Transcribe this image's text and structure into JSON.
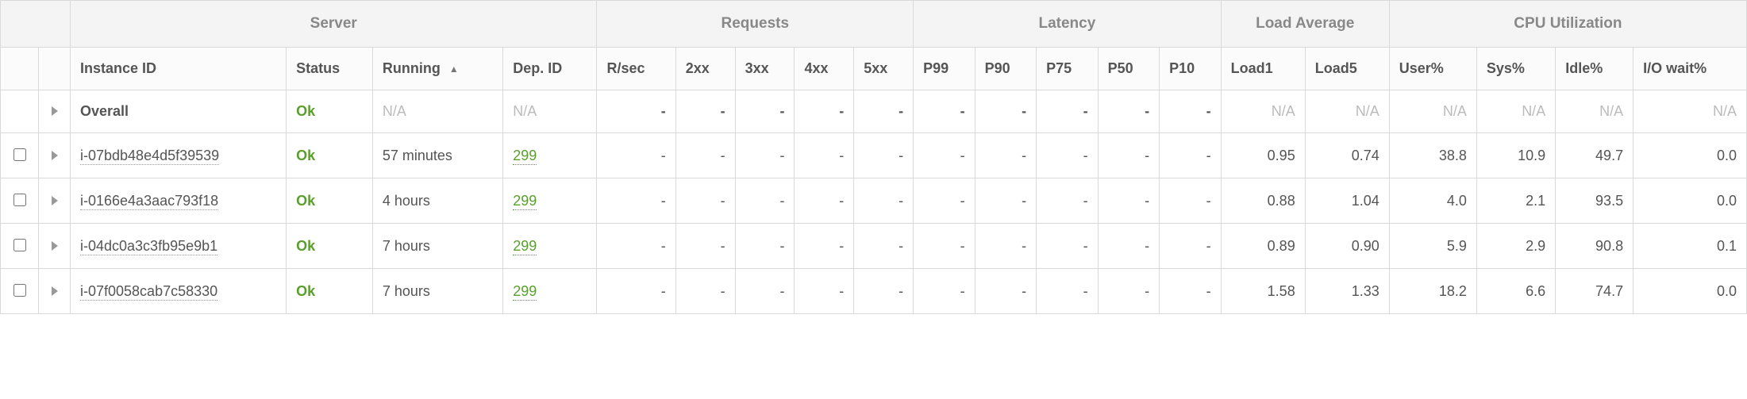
{
  "groups": {
    "server": "Server",
    "requests": "Requests",
    "latency": "Latency",
    "load": "Load Average",
    "cpu": "CPU Utilization"
  },
  "columns": {
    "instance_id": "Instance ID",
    "status": "Status",
    "running": "Running",
    "dep_id": "Dep. ID",
    "rsec": "R/sec",
    "c2xx": "2xx",
    "c3xx": "3xx",
    "c4xx": "4xx",
    "c5xx": "5xx",
    "p99": "P99",
    "p90": "P90",
    "p75": "P75",
    "p50": "P50",
    "p10": "P10",
    "load1": "Load1",
    "load5": "Load5",
    "user": "User%",
    "sys": "Sys%",
    "idle": "Idle%",
    "iowait": "I/O wait%"
  },
  "sort": {
    "column": "running",
    "indicator": "▲"
  },
  "na_label": "N/A",
  "dash": "-",
  "overall": {
    "label": "Overall",
    "status": "Ok",
    "running": "N/A",
    "dep_id": "N/A",
    "rsec": "-",
    "c2xx": "-",
    "c3xx": "-",
    "c4xx": "-",
    "c5xx": "-",
    "p99": "-",
    "p90": "-",
    "p75": "-",
    "p50": "-",
    "p10": "-",
    "load1": "N/A",
    "load5": "N/A",
    "user": "N/A",
    "sys": "N/A",
    "idle": "N/A",
    "iowait": "N/A"
  },
  "rows": [
    {
      "instance_id": "i-07bdb48e4d5f39539",
      "status": "Ok",
      "running": "57 minutes",
      "dep_id": "299",
      "rsec": "-",
      "c2xx": "-",
      "c3xx": "-",
      "c4xx": "-",
      "c5xx": "-",
      "p99": "-",
      "p90": "-",
      "p75": "-",
      "p50": "-",
      "p10": "-",
      "load1": "0.95",
      "load5": "0.74",
      "user": "38.8",
      "sys": "10.9",
      "idle": "49.7",
      "iowait": "0.0"
    },
    {
      "instance_id": "i-0166e4a3aac793f18",
      "status": "Ok",
      "running": "4 hours",
      "dep_id": "299",
      "rsec": "-",
      "c2xx": "-",
      "c3xx": "-",
      "c4xx": "-",
      "c5xx": "-",
      "p99": "-",
      "p90": "-",
      "p75": "-",
      "p50": "-",
      "p10": "-",
      "load1": "0.88",
      "load5": "1.04",
      "user": "4.0",
      "sys": "2.1",
      "idle": "93.5",
      "iowait": "0.0"
    },
    {
      "instance_id": "i-04dc0a3c3fb95e9b1",
      "status": "Ok",
      "running": "7 hours",
      "dep_id": "299",
      "rsec": "-",
      "c2xx": "-",
      "c3xx": "-",
      "c4xx": "-",
      "c5xx": "-",
      "p99": "-",
      "p90": "-",
      "p75": "-",
      "p50": "-",
      "p10": "-",
      "load1": "0.89",
      "load5": "0.90",
      "user": "5.9",
      "sys": "2.9",
      "idle": "90.8",
      "iowait": "0.1"
    },
    {
      "instance_id": "i-07f0058cab7c58330",
      "status": "Ok",
      "running": "7 hours",
      "dep_id": "299",
      "rsec": "-",
      "c2xx": "-",
      "c3xx": "-",
      "c4xx": "-",
      "c5xx": "-",
      "p99": "-",
      "p90": "-",
      "p75": "-",
      "p50": "-",
      "p10": "-",
      "load1": "1.58",
      "load5": "1.33",
      "user": "18.2",
      "sys": "6.6",
      "idle": "74.7",
      "iowait": "0.0"
    }
  ]
}
